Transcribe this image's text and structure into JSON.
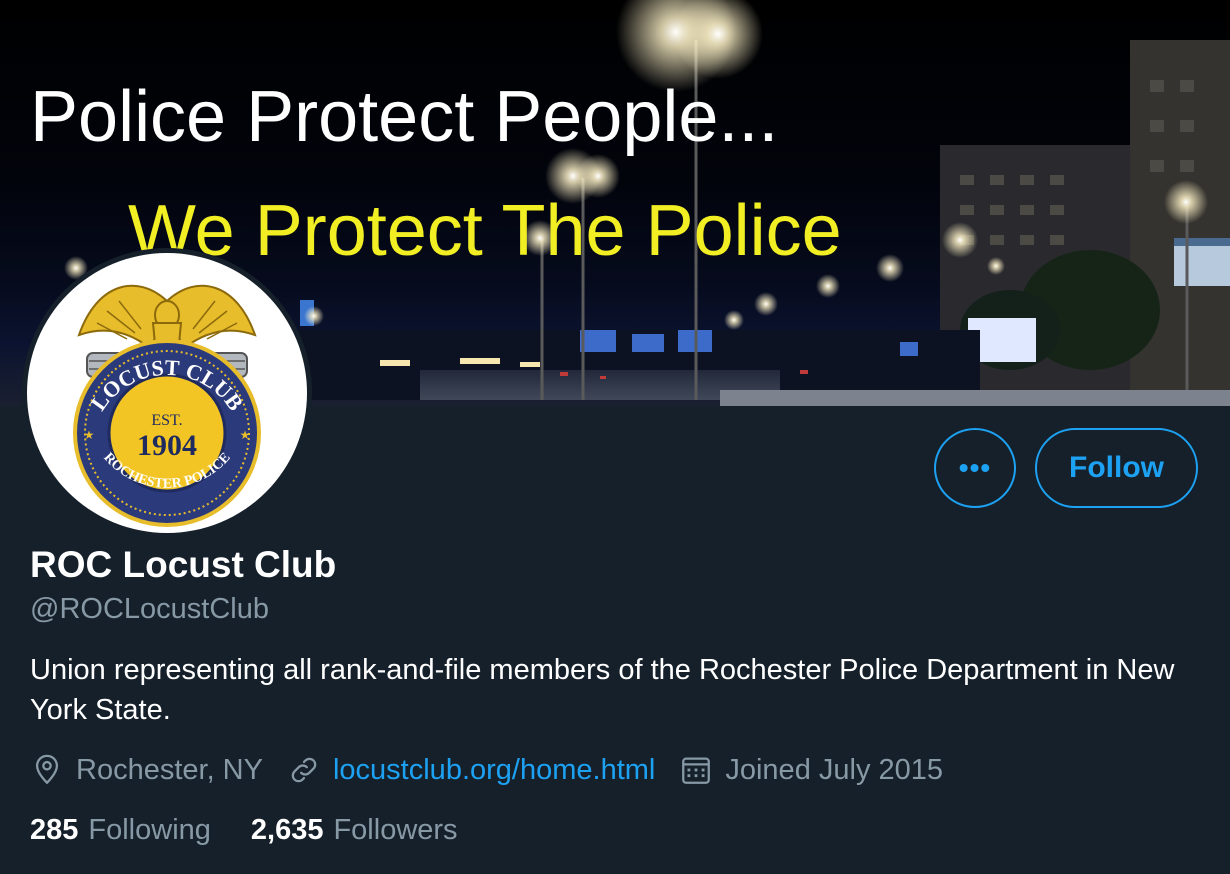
{
  "banner": {
    "line1": "Police Protect People...",
    "line2": "We Protect The Police"
  },
  "avatar": {
    "top_arc_text": "LOCUST CLUB",
    "bottom_arc_text": "ROCHESTER POLICE",
    "est_label": "EST.",
    "year": "1904"
  },
  "actions": {
    "more_label": "•••",
    "follow_label": "Follow"
  },
  "profile": {
    "display_name": "ROC Locust Club",
    "handle": "@ROCLocustClub",
    "bio": "Union representing all rank-and-file members of the Rochester Police Department in New York State.",
    "location": "Rochester, NY",
    "website": "locustclub.org/home.html",
    "joined": "Joined July 2015"
  },
  "stats": {
    "following_count": "285",
    "following_label": "Following",
    "followers_count": "2,635",
    "followers_label": "Followers"
  },
  "colors": {
    "background": "#15202b",
    "accent": "#1da1f2",
    "secondary_text": "#8899a6",
    "banner_yellow": "#f1ee24"
  },
  "icons": {
    "location": "location-pin-icon",
    "website": "link-icon",
    "joined": "calendar-icon"
  }
}
